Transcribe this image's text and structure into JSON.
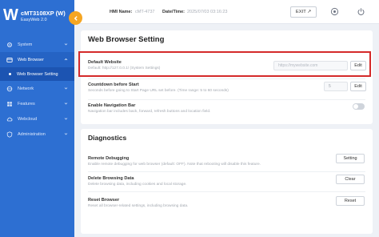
{
  "brand": {
    "logo": "W",
    "model": "cMT3108XP (W)",
    "edition": "EasyWeb 2.0"
  },
  "sidebar": {
    "items": [
      {
        "label": "System",
        "icon": "gear-icon"
      },
      {
        "label": "Web Browser",
        "icon": "globe-icon"
      },
      {
        "label": "Network",
        "icon": "network-icon"
      },
      {
        "label": "Features",
        "icon": "features-icon"
      },
      {
        "label": "Webcloud",
        "icon": "cloud-icon"
      },
      {
        "label": "Administration",
        "icon": "shield-icon"
      }
    ],
    "active_sub": "Web Browser Setting"
  },
  "topbar": {
    "hmi_name_label": "HMI Name:",
    "hmi_name_value": "cMT-4737",
    "datetime_label": "Date/Time:",
    "datetime_value": "2025/07/03 03:16:23",
    "exit_label": "EXIT ↗"
  },
  "web_browser_setting": {
    "title": "Web Browser Setting",
    "default_website": {
      "title": "Default Website",
      "desc": "Default: http://127.0.0.1/ (System Settings)",
      "value": "https://mywebsite.com",
      "button": "Edit"
    },
    "countdown": {
      "title": "Countdown before Start",
      "desc": "Seconds before going to Start Page URL set before. (Time range: 5 to 60 seconds)",
      "value": "5",
      "button": "Edit"
    },
    "navigation_bar": {
      "title": "Enable Navigation Bar",
      "desc": "Navigation bar includes back, forward, refresh buttons and location field."
    }
  },
  "diagnostics": {
    "title": "Diagnostics",
    "remote_debugging": {
      "title": "Remote Debugging",
      "desc": "Enable remote debugging for web browser (default: OFF). Note that rebooting will disable this feature.",
      "button": "Setting"
    },
    "delete_browsing_data": {
      "title": "Delete Browsing Data",
      "desc": "Delete browsing data, including cookies and local storage.",
      "button": "Clear"
    },
    "reset_browser": {
      "title": "Reset Browser",
      "desc": "Reset all browser-related settings, including browsing data.",
      "button": "Reset"
    }
  },
  "colors": {
    "sidebar": "#2d6fd2",
    "accent": "#f5a623",
    "highlight": "#d42a2a"
  }
}
